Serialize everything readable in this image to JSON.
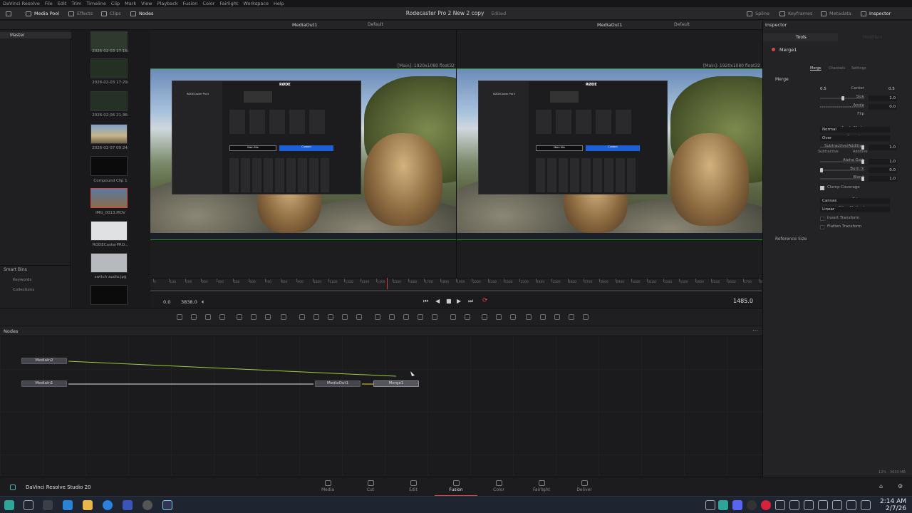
{
  "menubar": {
    "items": [
      "DaVinci Resolve",
      "File",
      "Edit",
      "Trim",
      "Timeline",
      "Clip",
      "Mark",
      "View",
      "Playback",
      "Fusion",
      "Color",
      "Fairlight",
      "Workspace",
      "Help"
    ]
  },
  "toolbar": {
    "media_pool": "Media Pool",
    "effects": "Effects",
    "clips": "Clips",
    "nodes": "Nodes",
    "project_title": "Rodecaster Pro 2 New 2 copy",
    "edited": "Edited",
    "spline": "Spline",
    "keyframes": "Keyframes",
    "metadata": "Metadata",
    "inspector": "Inspector"
  },
  "bins": {
    "master": "Master",
    "smart_bins": "Smart Bins",
    "keywords": "Keywords",
    "collections": "Collections"
  },
  "clips": [
    {
      "label": "2026-02-03 17:16:"
    },
    {
      "label": "2026-02-03 17:29:"
    },
    {
      "label": "2026-02-06 21:36:"
    },
    {
      "label": "2026-02-07 09:24:"
    },
    {
      "label": "Compound Clip 1"
    },
    {
      "label": "IMG_0013.MOV"
    },
    {
      "label": "RODECasterPRO..."
    },
    {
      "label": "switch audio.jpg"
    }
  ],
  "viewer_left": {
    "title": "MediaOut1",
    "mode": "Default",
    "info": "[Main]: 1920x1080 float32"
  },
  "viewer_right": {
    "title": "MediaOut1",
    "mode": "Default",
    "info": "[Main]: 1920x1080 float32"
  },
  "app_in_viewer": {
    "brand": "RØDE",
    "device": "RØDECaster Pro II",
    "tabs": [
      "Output",
      "Faders",
      "Switch"
    ],
    "menu": [
      "Headphones",
      "Monitor",
      "Routing",
      "Listen",
      "Multitrack",
      "Processing"
    ],
    "mix": "Main Mix",
    "custom": "Custom"
  },
  "ruler": {
    "ticks": [
      "0",
      "100",
      "200",
      "300",
      "400",
      "500",
      "600",
      "700",
      "800",
      "900",
      "1000",
      "1100",
      "1200",
      "1300",
      "1400",
      "1500",
      "1600",
      "1700",
      "1800",
      "1900",
      "2000",
      "2100",
      "2200",
      "2300",
      "2400",
      "2500",
      "2600",
      "2700",
      "2800",
      "2900",
      "3000",
      "3100",
      "3200",
      "3300",
      "3400",
      "3500",
      "3600",
      "3700",
      "3800"
    ]
  },
  "transport": {
    "start": "0.0",
    "end": "3838.0",
    "current": "1485.0"
  },
  "nodes_panel": {
    "title": "Nodes",
    "items": {
      "mediain2": "MediaIn2",
      "mediain1": "MediaIn1",
      "mediaout1": "MediaOut1",
      "merge1": "Merge1"
    }
  },
  "inspector": {
    "title": "Inspector",
    "tools_tab": "Tools",
    "modifiers_tab": "Modifiers",
    "node_name": "Merge1",
    "subtabs": [
      "Merge",
      "Channels",
      "Settings"
    ],
    "section": "Merge",
    "center_label": "Center",
    "center_x": "0.5",
    "center_y": "0.5",
    "size_label": "Size",
    "size_val": "1.0",
    "angle_label": "Angle",
    "angle_val": "0.0",
    "flip_label": "Flip",
    "apply_mode_label": "Apply Mode",
    "apply_mode": "Normal",
    "operator_label": "Operator",
    "operator": "Over",
    "subadd_label": "Subtractive/Additive",
    "subadd_val": "1.0",
    "subtractive": "Subtractive",
    "additive": "Additive",
    "alpha_gain_label": "Alpha Gain",
    "alpha_gain": "1.0",
    "burn_in_label": "Burn In",
    "burn_in": "0.0",
    "blend_label": "Blend",
    "blend": "1.0",
    "clamp_label": "Clamp Coverage",
    "edges_label": "Edges",
    "edges": "Canvas",
    "filter_label": "Filter Method",
    "filter": "Linear",
    "invert_label": "Invert Transform",
    "flatten_label": "Flatten Transform",
    "reference_size": "Reference Size",
    "status": "12% · 3633 MB"
  },
  "pages": [
    "Media",
    "Cut",
    "Edit",
    "Fusion",
    "Color",
    "Fairlight",
    "Deliver"
  ],
  "brand": "DaVinci Resolve Studio 20",
  "clock": {
    "time": "2:14 AM",
    "date": "2/7/26"
  }
}
